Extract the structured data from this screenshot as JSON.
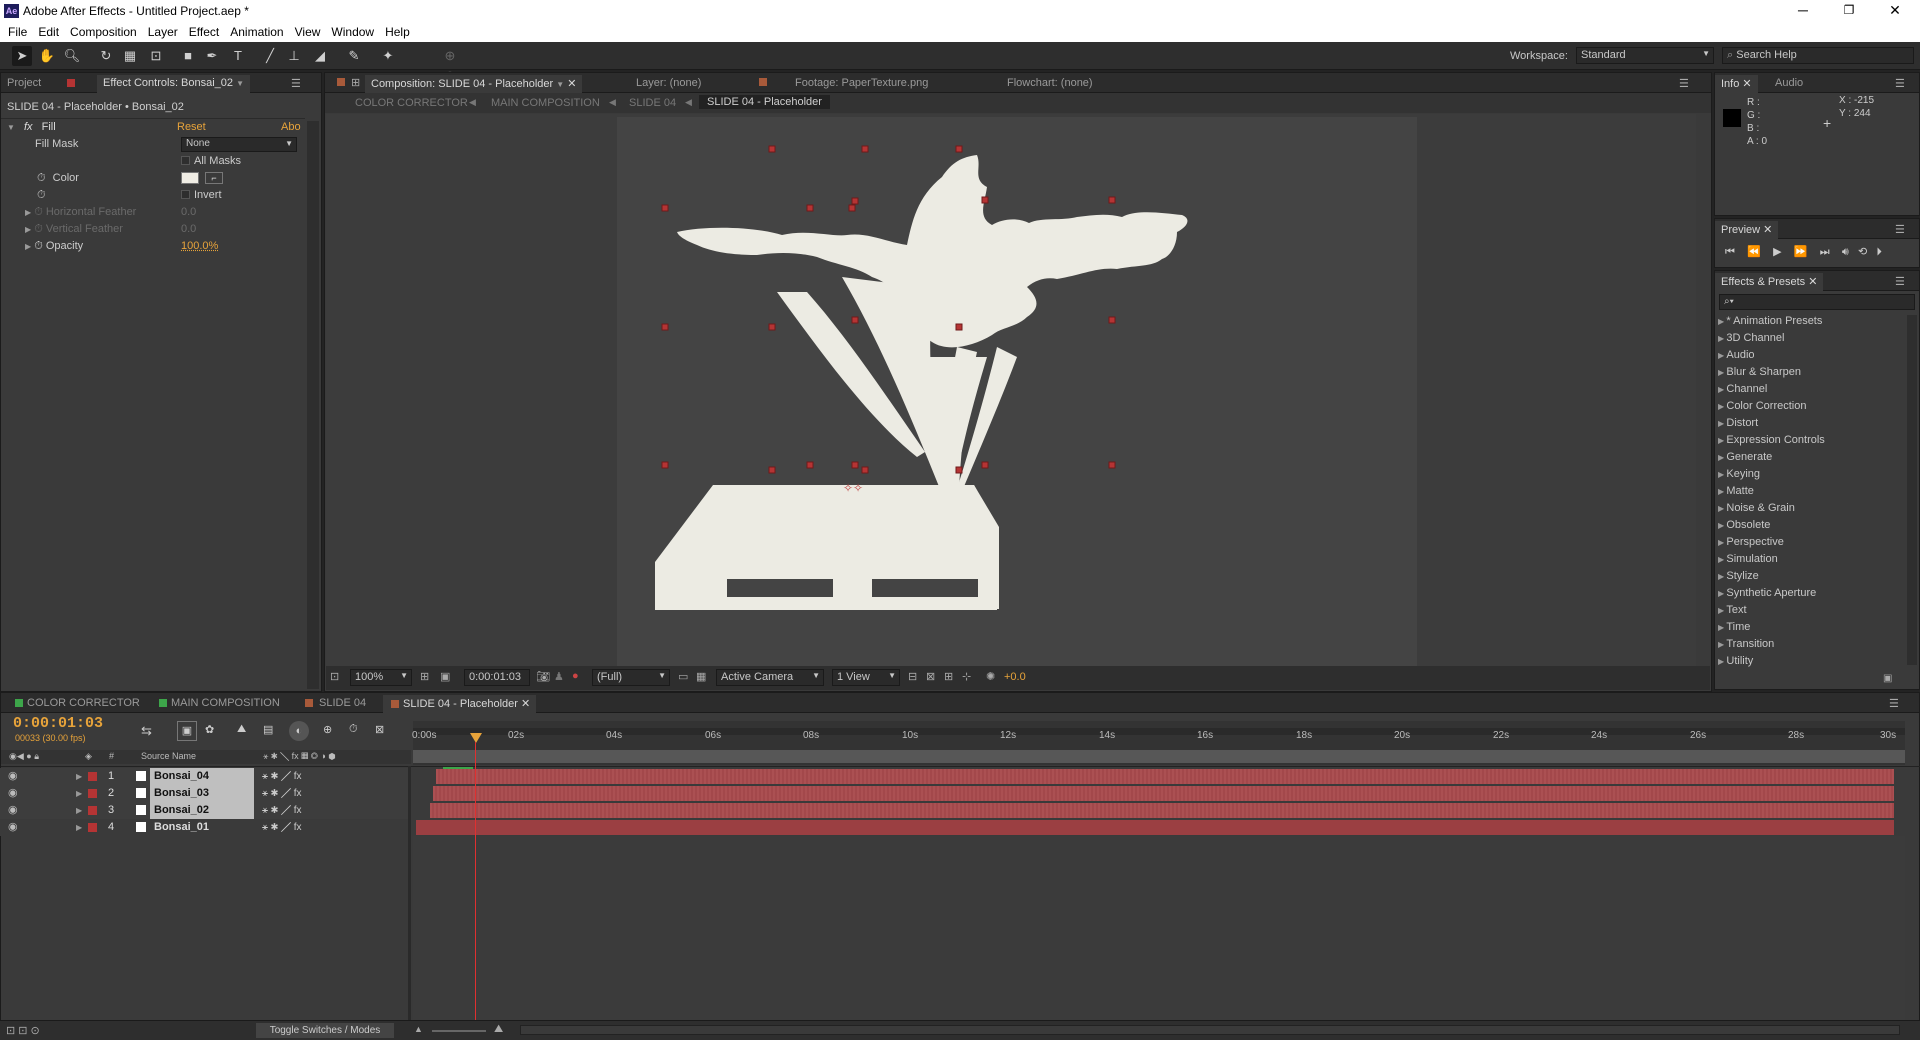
{
  "window": {
    "app_logo": "Ae",
    "title": "Adobe After Effects - Untitled Project.aep *",
    "minimize": "─",
    "maximize": "❐",
    "close": "✕"
  },
  "menu": [
    "File",
    "Edit",
    "Composition",
    "Layer",
    "Effect",
    "Animation",
    "View",
    "Window",
    "Help"
  ],
  "toolbar": {
    "workspace_label": "Workspace:",
    "workspace_value": "Standard",
    "search_placeholder": "Search Help"
  },
  "project_panel": {
    "tab_project": "Project",
    "tab_effect_controls": "Effect Controls: Bonsai_02",
    "layer_path": "SLIDE 04 - Placeholder • Bonsai_02",
    "effect_name": "Fill",
    "reset": "Reset",
    "about": "Abo",
    "fill_mask_label": "Fill Mask",
    "fill_mask_value": "None",
    "all_masks": "All Masks",
    "color_label": "Color",
    "invert": "Invert",
    "horizontal_feather": "Horizontal Feather",
    "horizontal_feather_value": "0.0",
    "vertical_feather": "Vertical Feather",
    "vertical_feather_value": "0.0",
    "opacity_label": "Opacity",
    "opacity_value": "100.0%",
    "fill_color": "#f0ede4"
  },
  "composition": {
    "tab_comp": "Composition: SLIDE 04 - Placeholder",
    "tab_layer": "Layer: (none)",
    "tab_footage": "Footage: PaperTexture.png",
    "tab_flowchart": "Flowchart: (none)",
    "breadcrumbs": [
      "COLOR CORRECTOR",
      "MAIN COMPOSITION",
      "SLIDE 04",
      "SLIDE 04 - Placeholder"
    ],
    "zoom": "100%",
    "timecode": "0:00:01:03",
    "resolution": "(Full)",
    "camera": "Active Camera",
    "views": "1 View",
    "exposure": "+0.0",
    "canvas_color": "#444444",
    "shape_color": "#ecebe3"
  },
  "info_panel": {
    "tab_info": "Info",
    "tab_audio": "Audio",
    "r": "R :",
    "g": "G :",
    "b": "B :",
    "a": "A : 0",
    "x": "X : -215",
    "y": "Y : 244"
  },
  "preview_panel": {
    "tab": "Preview"
  },
  "effects_panel": {
    "tab": "Effects & Presets",
    "items": [
      "* Animation Presets",
      "3D Channel",
      "Audio",
      "Blur & Sharpen",
      "Channel",
      "Color Correction",
      "Distort",
      "Expression Controls",
      "Generate",
      "Keying",
      "Matte",
      "Noise & Grain",
      "Obsolete",
      "Perspective",
      "Simulation",
      "Stylize",
      "Synthetic Aperture",
      "Text",
      "Time",
      "Transition",
      "Utility"
    ]
  },
  "timeline": {
    "tabs": [
      "COLOR CORRECTOR",
      "MAIN COMPOSITION",
      "SLIDE 04",
      "SLIDE 04 - Placeholder"
    ],
    "tab_colors": [
      "#3da54a",
      "#3da54a",
      "#a85a3a",
      "#a85a3a"
    ],
    "timecode": "0:00:01:03",
    "frame_info": "00033 (30.00 fps)",
    "source_name_header": "Source Name",
    "hash_header": "#",
    "ruler": [
      "0:00s",
      "02s",
      "04s",
      "06s",
      "08s",
      "10s",
      "12s",
      "14s",
      "16s",
      "18s",
      "20s",
      "22s",
      "24s",
      "26s",
      "28s",
      "30s"
    ],
    "layers": [
      {
        "num": "1",
        "name": "Bonsai_04"
      },
      {
        "num": "2",
        "name": "Bonsai_03"
      },
      {
        "num": "3",
        "name": "Bonsai_02"
      },
      {
        "num": "4",
        "name": "Bonsai_01"
      }
    ],
    "toggle_label": "Toggle Switches / Modes",
    "layer_color": "#b53434",
    "bar_color": "#a84a4d",
    "playhead_color": "#e03030"
  }
}
